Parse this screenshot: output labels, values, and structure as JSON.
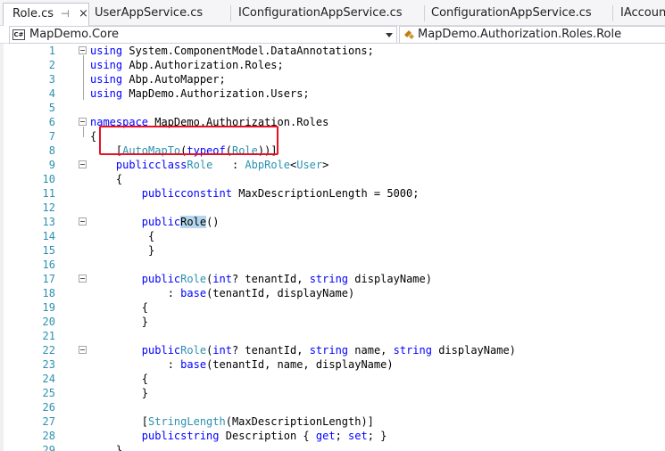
{
  "tabs": [
    {
      "label": "Role.cs",
      "pin": "⊣",
      "close": "×",
      "active": true
    },
    {
      "label": "UserAppService.cs",
      "active": false
    },
    {
      "label": "IConfigurationAppService.cs",
      "active": false
    },
    {
      "label": "ConfigurationAppService.cs",
      "active": false
    },
    {
      "label": "IAccount",
      "active": false
    }
  ],
  "navbar": {
    "project_icon": "C#",
    "project": "MapDemo.Core",
    "member": "MapDemo.Authorization.Roles.Role"
  },
  "highlight_color": "#e81123",
  "lines": [
    {
      "n": "1",
      "tokens": [
        [
          "kw",
          "using"
        ],
        [
          "",
          "System.ComponentModel.DataAnnotations;"
        ]
      ]
    },
    {
      "n": "2",
      "tokens": [
        [
          "kw",
          "using"
        ],
        [
          "",
          "Abp.Authorization.Roles;"
        ]
      ]
    },
    {
      "n": "3",
      "tokens": [
        [
          "kw",
          "using"
        ],
        [
          "",
          "Abp.AutoMapper;"
        ]
      ]
    },
    {
      "n": "4",
      "tokens": [
        [
          "kw",
          "using"
        ],
        [
          "",
          "MapDemo.Authorization.Users;"
        ]
      ]
    },
    {
      "n": "5",
      "tokens": []
    },
    {
      "n": "6",
      "tokens": [
        [
          "kw",
          "namespace"
        ],
        [
          "",
          "MapDemo.Authorization.Roles"
        ]
      ]
    },
    {
      "n": "7",
      "tokens": [
        [
          "",
          "{"
        ]
      ]
    },
    {
      "n": "8",
      "tokens": [
        [
          "",
          "    ["
        ],
        [
          "ty",
          "AutoMapTo"
        ],
        [
          "",
          "("
        ],
        [
          "kw",
          "typeof"
        ],
        [
          "",
          "("
        ],
        [
          "ty",
          "Role"
        ],
        [
          "",
          "))]"
        ]
      ]
    },
    {
      "n": "9",
      "tokens": [
        [
          "",
          "    "
        ],
        [
          "kw",
          "public"
        ],
        [
          "",
          ""
        ],
        [
          "kw",
          "class"
        ],
        [
          "",
          ""
        ],
        [
          "ty",
          "Role"
        ],
        [
          "",
          "  : "
        ],
        [
          "ty",
          "AbpRole"
        ],
        [
          "",
          "<"
        ],
        [
          "ty",
          "User"
        ],
        [
          "",
          ">"
        ]
      ]
    },
    {
      "n": "10",
      "tokens": [
        [
          "",
          "    {"
        ]
      ]
    },
    {
      "n": "11",
      "tokens": [
        [
          "",
          "        "
        ],
        [
          "kw",
          "public"
        ],
        [
          "",
          ""
        ],
        [
          "kw",
          "const"
        ],
        [
          "",
          ""
        ],
        [
          "kw",
          "int"
        ],
        [
          "",
          "MaxDescriptionLength = 5000;"
        ]
      ]
    },
    {
      "n": "12",
      "tokens": []
    },
    {
      "n": "13",
      "tokens": [
        [
          "",
          "        "
        ],
        [
          "kw",
          "public"
        ],
        [
          "",
          ""
        ],
        [
          "hl",
          "Role"
        ],
        [
          "",
          "()"
        ]
      ]
    },
    {
      "n": "14",
      "tokens": [
        [
          "",
          "         {"
        ]
      ]
    },
    {
      "n": "15",
      "tokens": [
        [
          "",
          "         }"
        ]
      ]
    },
    {
      "n": "16",
      "tokens": []
    },
    {
      "n": "17",
      "tokens": [
        [
          "",
          "        "
        ],
        [
          "kw",
          "public"
        ],
        [
          "",
          ""
        ],
        [
          "ty",
          "Role"
        ],
        [
          "",
          "("
        ],
        [
          "kw",
          "int"
        ],
        [
          "",
          "? tenantId, "
        ],
        [
          "kw",
          "string"
        ],
        [
          "",
          "displayName)"
        ]
      ]
    },
    {
      "n": "18",
      "tokens": [
        [
          "",
          "            : "
        ],
        [
          "kw",
          "base"
        ],
        [
          "",
          "(tenantId, displayName)"
        ]
      ]
    },
    {
      "n": "19",
      "tokens": [
        [
          "",
          "        {"
        ]
      ]
    },
    {
      "n": "20",
      "tokens": [
        [
          "",
          "        }"
        ]
      ]
    },
    {
      "n": "21",
      "tokens": []
    },
    {
      "n": "22",
      "tokens": [
        [
          "",
          "        "
        ],
        [
          "kw",
          "public"
        ],
        [
          "",
          ""
        ],
        [
          "ty",
          "Role"
        ],
        [
          "",
          "("
        ],
        [
          "kw",
          "int"
        ],
        [
          "",
          "? tenantId, "
        ],
        [
          "kw",
          "string"
        ],
        [
          "",
          "name, "
        ],
        [
          "kw",
          "string"
        ],
        [
          "",
          "displayName)"
        ]
      ]
    },
    {
      "n": "23",
      "tokens": [
        [
          "",
          "            : "
        ],
        [
          "kw",
          "base"
        ],
        [
          "",
          "(tenantId, name, displayName)"
        ]
      ]
    },
    {
      "n": "24",
      "tokens": [
        [
          "",
          "        {"
        ]
      ]
    },
    {
      "n": "25",
      "tokens": [
        [
          "",
          "        }"
        ]
      ]
    },
    {
      "n": "26",
      "tokens": []
    },
    {
      "n": "27",
      "tokens": [
        [
          "",
          "        ["
        ],
        [
          "ty",
          "StringLength"
        ],
        [
          "",
          "(MaxDescriptionLength)]"
        ]
      ]
    },
    {
      "n": "28",
      "tokens": [
        [
          "",
          "        "
        ],
        [
          "kw",
          "public"
        ],
        [
          "",
          ""
        ],
        [
          "kw",
          "string"
        ],
        [
          "",
          "Description { "
        ],
        [
          "kw",
          "get"
        ],
        [
          "",
          "; "
        ],
        [
          "kw",
          "set"
        ],
        [
          "",
          "; }"
        ]
      ]
    },
    {
      "n": "29",
      "tokens": [
        [
          "",
          "    }"
        ]
      ]
    }
  ]
}
